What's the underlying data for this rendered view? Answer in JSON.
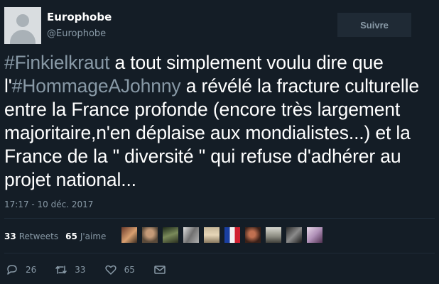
{
  "profile": {
    "name": "Europhobe",
    "handle": "@Europhobe",
    "follow_label": "Suivre"
  },
  "tweet": {
    "hashtag1": "#Finkielkraut",
    "text1": " a tout simplement voulu dire que l'",
    "hashtag2": "#HommageAJohnny",
    "text2": " a révélé la fracture culturelle entre la France profonde (encore très largement majoritaire,n'en déplaise aux mondialistes...) et la France de la \" diversité \" qui refuse d'adhérer au projet national...",
    "timestamp": "17:17 - 10 déc. 2017"
  },
  "stats": {
    "retweets_count": "33",
    "retweets_label": "Retweets",
    "likes_count": "65",
    "likes_label": "J'aime"
  },
  "actions": {
    "reply_count": "26",
    "retweet_count": "33",
    "like_count": "65"
  },
  "colors": {
    "background": "#141d26",
    "muted": "#8899a6",
    "text": "#ffffff"
  }
}
